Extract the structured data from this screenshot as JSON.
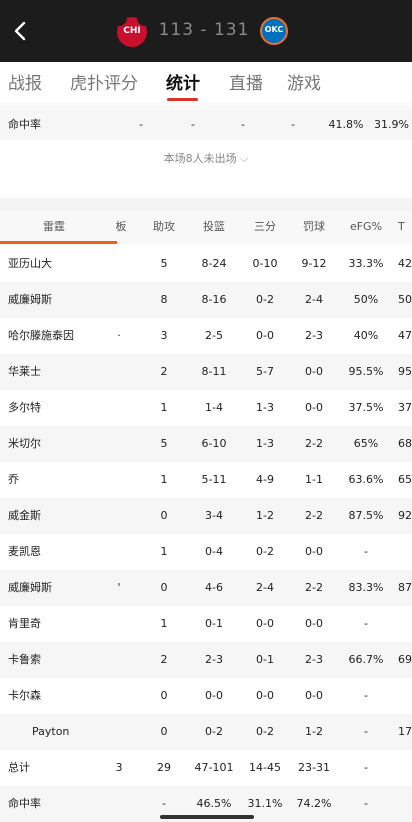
{
  "header": {
    "back_icon": "chevron-left-icon",
    "home_abbr": "CHI",
    "away_abbr": "OKC",
    "score": "113 - 131",
    "colors": {
      "bar": "#1c1c1c",
      "home": "#c8102e",
      "away": "#0070c0",
      "accent": "#d9322a"
    }
  },
  "tabs": [
    {
      "label": "战报",
      "active": false
    },
    {
      "label": "虎扑评分",
      "active": false
    },
    {
      "label": "统计",
      "active": true
    },
    {
      "label": "直播",
      "active": false
    },
    {
      "label": "游戏",
      "active": false
    }
  ],
  "prev_team_pct": {
    "label": "命中率",
    "values": [
      "-",
      "-",
      "-",
      "-",
      "41.8%",
      "31.9%"
    ]
  },
  "dnp_text": "本场8人未出场",
  "table": {
    "team_name": "雷霆",
    "columns": [
      "雷霆",
      "板",
      "助攻",
      "投篮",
      "三分",
      "罚球",
      "eFG%",
      "T"
    ],
    "rows": [
      [
        "亚历山大",
        "",
        "5",
        "8-24",
        "0-10",
        "9-12",
        "33.3%",
        "42"
      ],
      [
        "威廉姆斯",
        "",
        "8",
        "8-16",
        "0-2",
        "2-4",
        "50%",
        "50"
      ],
      [
        "哈尔滕施泰因",
        "·",
        "3",
        "2-5",
        "0-0",
        "2-3",
        "40%",
        "47"
      ],
      [
        "华莱士",
        "",
        "2",
        "8-11",
        "5-7",
        "0-0",
        "95.5%",
        "95"
      ],
      [
        "多尔特",
        "",
        "1",
        "1-4",
        "1-3",
        "0-0",
        "37.5%",
        "37"
      ],
      [
        "米切尔",
        "",
        "5",
        "6-10",
        "1-3",
        "2-2",
        "65%",
        "68"
      ],
      [
        "乔",
        "",
        "1",
        "5-11",
        "4-9",
        "1-1",
        "63.6%",
        "65"
      ],
      [
        "威金斯",
        "",
        "0",
        "3-4",
        "1-2",
        "2-2",
        "87.5%",
        "92"
      ],
      [
        "麦凯恩",
        "",
        "1",
        "0-4",
        "0-2",
        "0-0",
        "-",
        ""
      ],
      [
        "威廉姆斯",
        "'",
        "0",
        "4-6",
        "2-4",
        "2-2",
        "83.3%",
        "87"
      ],
      [
        "肯里奇",
        "",
        "1",
        "0-1",
        "0-0",
        "0-0",
        "-",
        ""
      ],
      [
        "卡鲁索",
        "",
        "2",
        "2-3",
        "0-1",
        "2-3",
        "66.7%",
        "69"
      ],
      [
        "卡尔森",
        "",
        "0",
        "0-0",
        "0-0",
        "0-0",
        "-",
        ""
      ],
      [
        "Payton",
        "",
        "0",
        "0-2",
        "0-2",
        "1-2",
        "-",
        "17"
      ],
      [
        "总计",
        "3",
        "29",
        "47-101",
        "14-45",
        "23-31",
        "-",
        ""
      ],
      [
        "命中率",
        "",
        "-",
        "46.5%",
        "31.1%",
        "74.2%",
        "-",
        ""
      ]
    ]
  }
}
